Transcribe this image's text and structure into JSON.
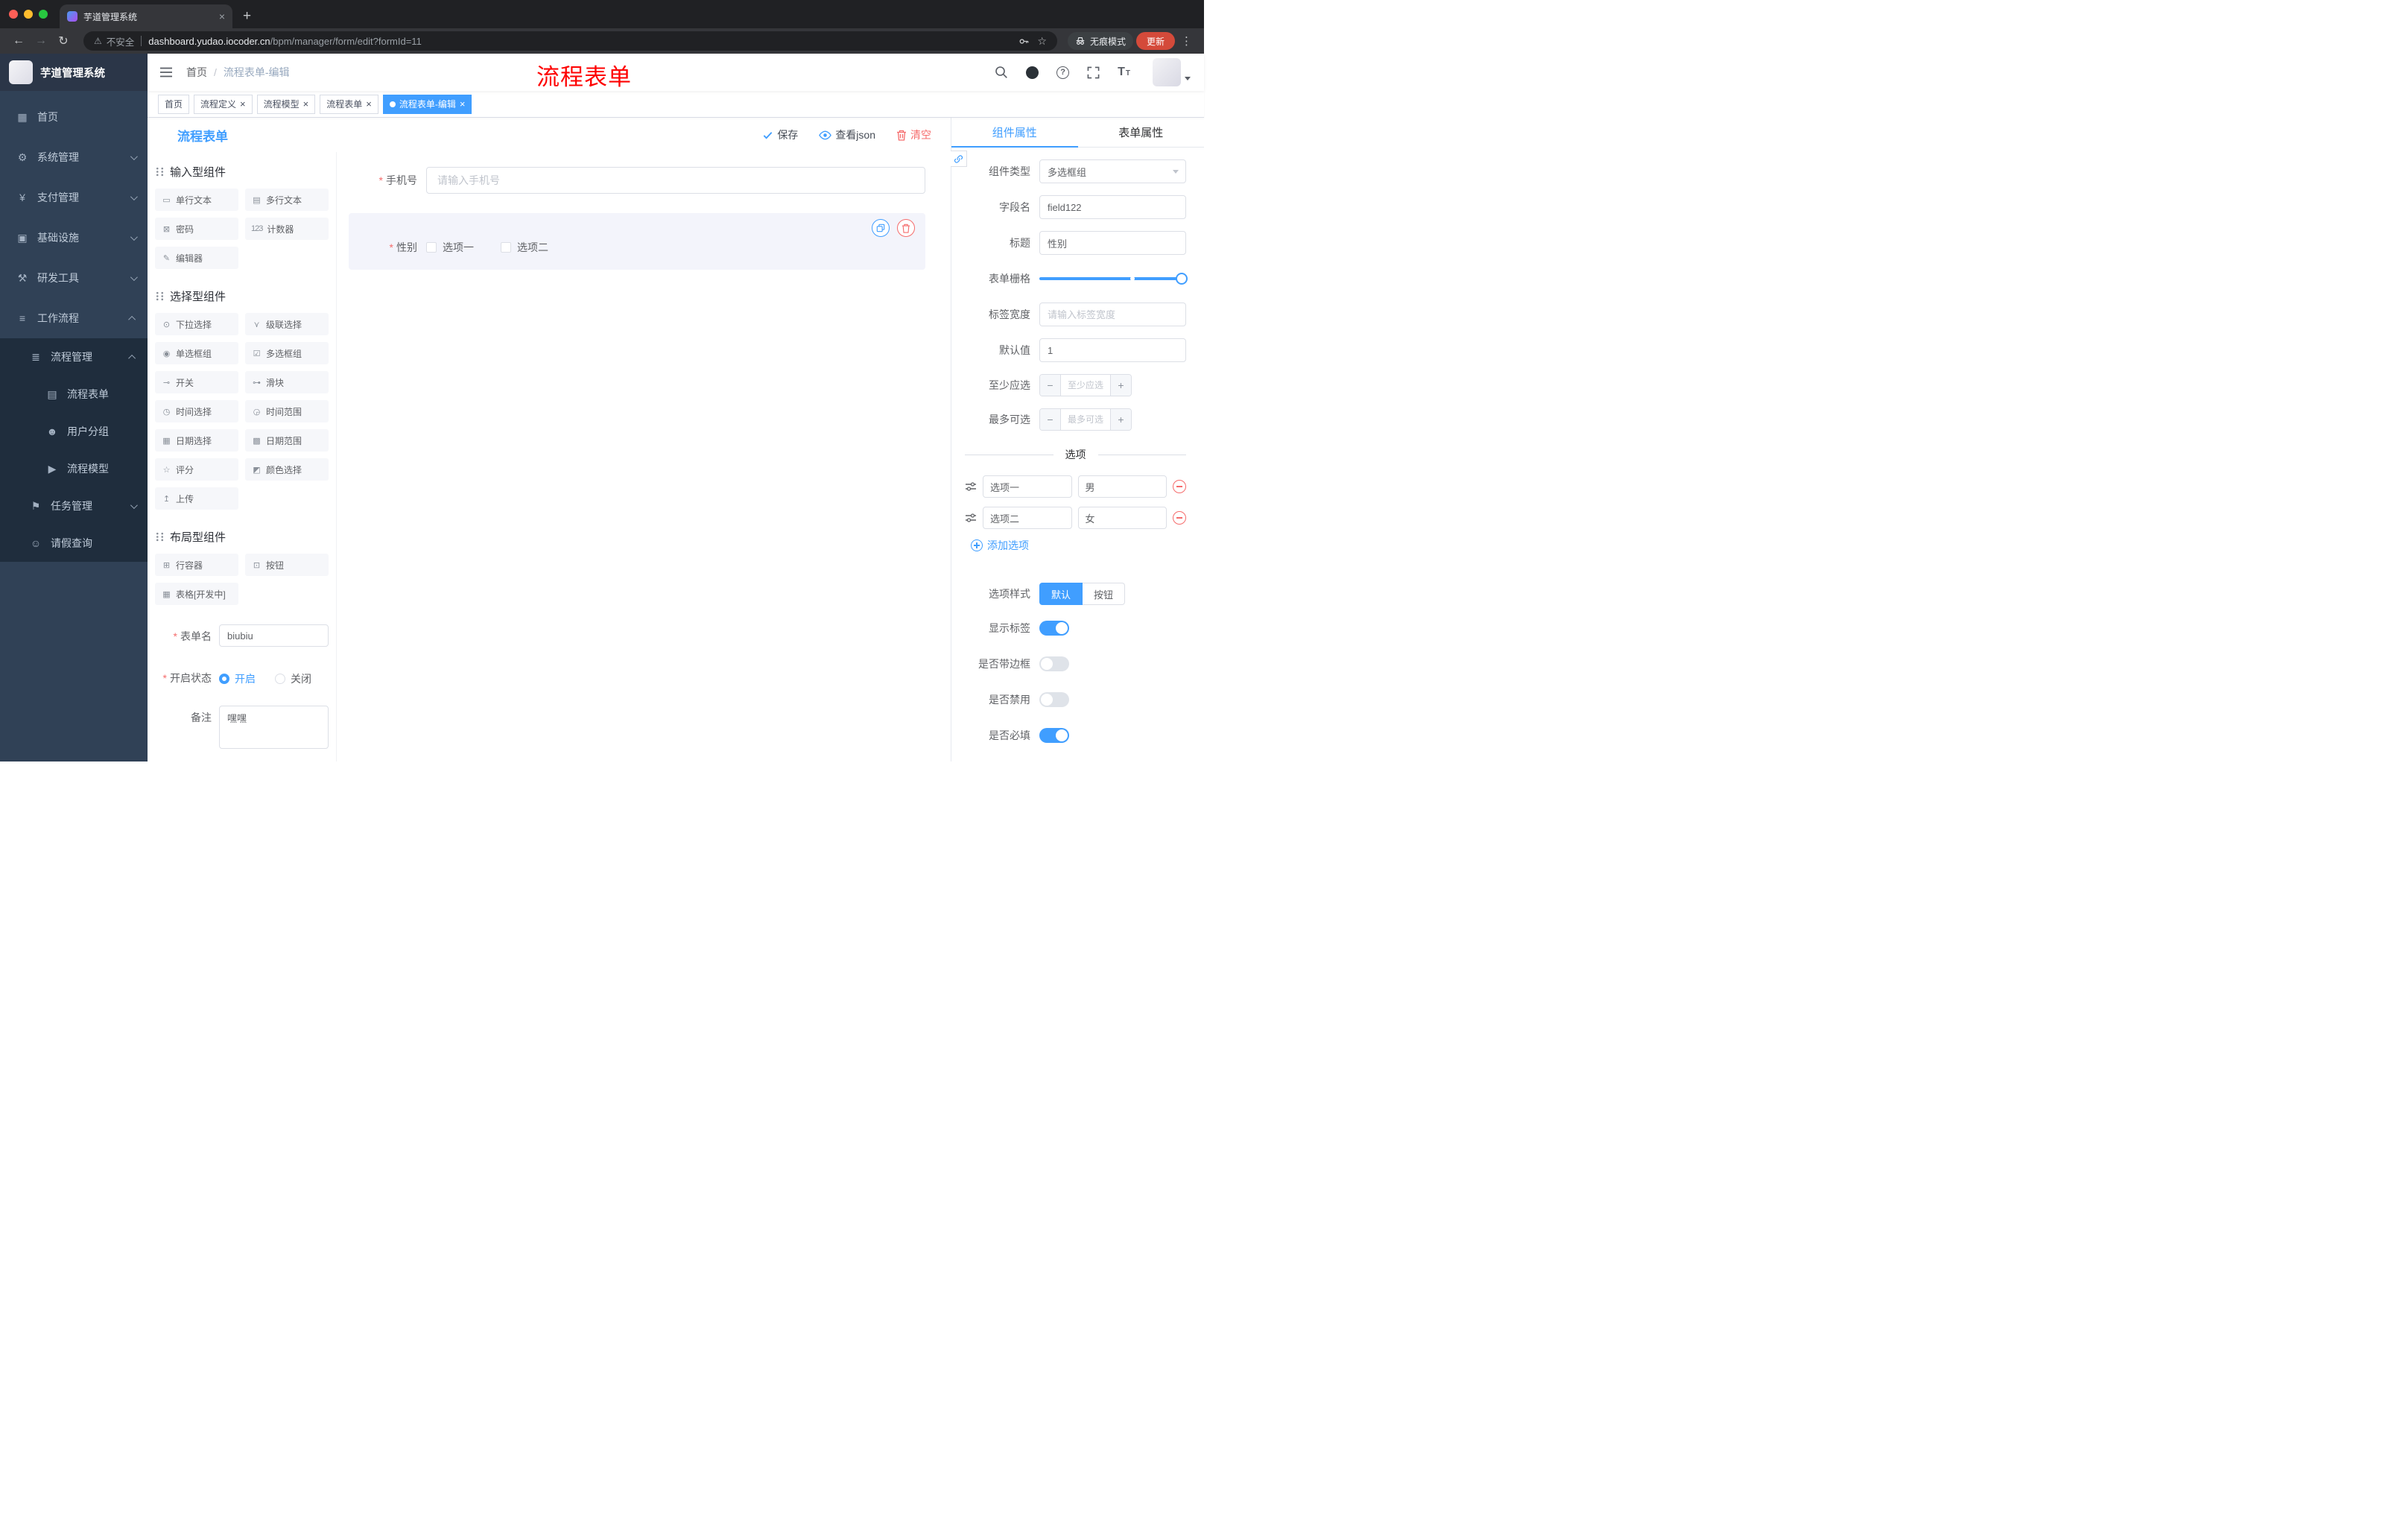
{
  "colors": {
    "accent": "#409EFF",
    "danger": "#F56C6C",
    "annotation_red": "#FF0000",
    "sidebar_bg": "#304156",
    "sidebar_submenu_bg": "#1F2D3D",
    "active_tab_bg": "#409EFF"
  },
  "browser": {
    "tab_title": "芋道管理系统",
    "security_label": "不安全",
    "url_domain": "dashboard.yudao.iocoder.cn",
    "url_path": "/bpm/manager/form/edit?formId=11",
    "incognito_label": "无痕模式",
    "update_label": "更新"
  },
  "sidebar": {
    "logo_text": "芋道管理系统",
    "items": [
      {
        "label": "首页",
        "glyph": "▦"
      },
      {
        "label": "系统管理",
        "glyph": "⚙"
      },
      {
        "label": "支付管理",
        "glyph": "¥"
      },
      {
        "label": "基础设施",
        "glyph": "▣"
      },
      {
        "label": "研发工具",
        "glyph": "⚒"
      },
      {
        "label": "工作流程",
        "glyph": "≡"
      },
      {
        "label": "流程管理",
        "glyph": "≣"
      },
      {
        "label": "流程表单",
        "glyph": "▤"
      },
      {
        "label": "用户分组",
        "glyph": "☻"
      },
      {
        "label": "流程模型",
        "glyph": "▶"
      },
      {
        "label": "任务管理",
        "glyph": "⚑"
      },
      {
        "label": "请假查询",
        "glyph": "☺"
      }
    ]
  },
  "header": {
    "breadcrumb_home": "首页",
    "breadcrumb_sep": "/",
    "breadcrumb_current": "流程表单-编辑",
    "annotation": "流程表单"
  },
  "tags": [
    {
      "label": "首页"
    },
    {
      "label": "流程定义"
    },
    {
      "label": "流程模型"
    },
    {
      "label": "流程表单"
    },
    {
      "label": "流程表单-编辑"
    }
  ],
  "designer": {
    "title": "流程表单",
    "actions": {
      "save": "保存",
      "view_json": "查看json",
      "clear": "清空"
    },
    "groups": [
      {
        "title": "输入型组件",
        "items": [
          {
            "label": "单行文本",
            "glyph": "▭"
          },
          {
            "label": "多行文本",
            "glyph": "▤"
          },
          {
            "label": "密码",
            "glyph": "⊠"
          },
          {
            "label": "计数器",
            "glyph": "123"
          },
          {
            "label": "编辑器",
            "glyph": "✎"
          }
        ]
      },
      {
        "title": "选择型组件",
        "items": [
          {
            "label": "下拉选择",
            "glyph": "⊙"
          },
          {
            "label": "级联选择",
            "glyph": "⋎"
          },
          {
            "label": "单选框组",
            "glyph": "◉"
          },
          {
            "label": "多选框组",
            "glyph": "☑"
          },
          {
            "label": "开关",
            "glyph": "⊸"
          },
          {
            "label": "滑块",
            "glyph": "⊶"
          },
          {
            "label": "时间选择",
            "glyph": "◷"
          },
          {
            "label": "时间范围",
            "glyph": "◶"
          },
          {
            "label": "日期选择",
            "glyph": "▦"
          },
          {
            "label": "日期范围",
            "glyph": "▩"
          },
          {
            "label": "评分",
            "glyph": "☆"
          },
          {
            "label": "颜色选择",
            "glyph": "◩"
          },
          {
            "label": "上传",
            "glyph": "↥"
          }
        ]
      },
      {
        "title": "布局型组件",
        "items": [
          {
            "label": "行容器",
            "glyph": "⊞"
          },
          {
            "label": "按钮",
            "glyph": "⊡"
          },
          {
            "label": "表格[开发中]",
            "glyph": "▦"
          }
        ]
      }
    ],
    "meta": {
      "name_label": "表单名",
      "name_value": "biubiu",
      "status_label": "开启状态",
      "status_on": "开启",
      "status_off": "关闭",
      "remark_label": "备注",
      "remark_value": "嘿嘿"
    },
    "canvas": {
      "phone_label": "手机号",
      "phone_placeholder": "请输入手机号",
      "gender_label": "性别",
      "gender_option1": "选项一",
      "gender_option2": "选项二"
    }
  },
  "props": {
    "tabs": {
      "component": "组件属性",
      "form": "表单属性"
    },
    "type_label": "组件类型",
    "type_value": "多选框组",
    "field_label": "字段名",
    "field_value": "field122",
    "title_label": "标题",
    "title_value": "性别",
    "grid_label": "表单栅格",
    "label_width_label": "标签宽度",
    "label_width_placeholder": "请输入标签宽度",
    "default_label": "默认值",
    "default_value": "1",
    "min_label": "至少应选",
    "min_placeholder": "至少应选",
    "max_label": "最多可选",
    "max_placeholder": "最多可选",
    "options_divider": "选项",
    "options": [
      {
        "label": "选项一",
        "value": "男"
      },
      {
        "label": "选项二",
        "value": "女"
      }
    ],
    "add_option_label": "添加选项",
    "option_style_label": "选项样式",
    "option_style_default": "默认",
    "option_style_button": "按钮",
    "switches": [
      {
        "label": "显示标签",
        "on": true
      },
      {
        "label": "是否带边框",
        "on": false
      },
      {
        "label": "是否禁用",
        "on": false
      },
      {
        "label": "是否必填",
        "on": true
      }
    ]
  }
}
